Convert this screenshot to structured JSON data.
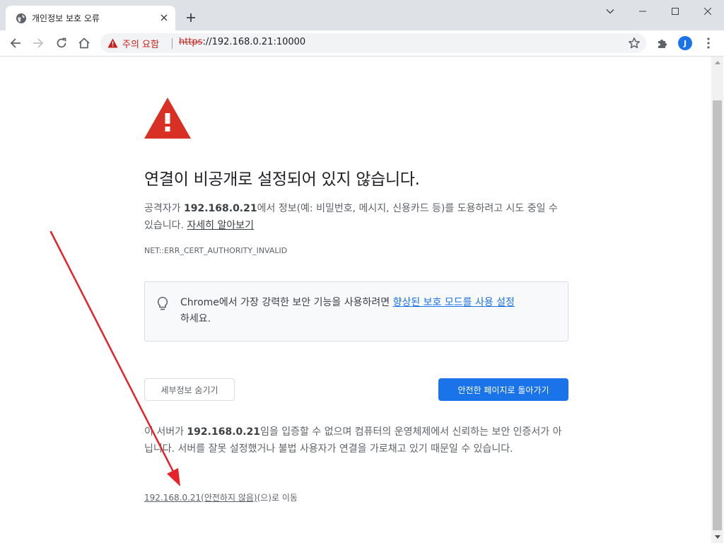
{
  "browser": {
    "tab": {
      "title": "개인정보 보호 오류"
    },
    "omnibox": {
      "warning_label": "주의 요함",
      "url_scheme": "https",
      "url_rest": "://192.168.0.21:10000"
    },
    "profile_initial": "J"
  },
  "page": {
    "heading": "연결이 비공개로 설정되어 있지 않습니다.",
    "intro": {
      "prefix": "공격자가 ",
      "host": "192.168.0.21",
      "suffix": "에서 정보(예: 비밀번호, 메시지, 신용카드 등)를 도용하려고 시도 중일 수 있습니다. ",
      "learn_more": "자세히 알아보기"
    },
    "error_code": "NET::ERR_CERT_AUTHORITY_INVALID",
    "promo": {
      "prefix": "Chrome에서 가장 강력한 보안 기능을 사용하려면 ",
      "link": "향상된 보호 모드를 사용 설정",
      "suffix": "하세요."
    },
    "buttons": {
      "details": "세부정보 숨기기",
      "back_to_safety": "안전한 페이지로 돌아가기"
    },
    "details": {
      "prefix": "이 서버가 ",
      "host": "192.168.0.21",
      "suffix": "임을 입증할 수 없으며 컴퓨터의 운영체제에서 신뢰하는 보안 인증서가 아닙니다. 서버를 잘못 설정했거나 불법 사용자가 연결을 가로채고 있기 때문일 수 있습니다."
    },
    "proceed": {
      "link": "192.168.0.21(안전하지 않음)",
      "suffix": "(으)로 이동"
    }
  },
  "colors": {
    "accent_blue": "#1a73e8",
    "warning_red": "#d93025",
    "annotation_arrow": "#e8222a"
  }
}
